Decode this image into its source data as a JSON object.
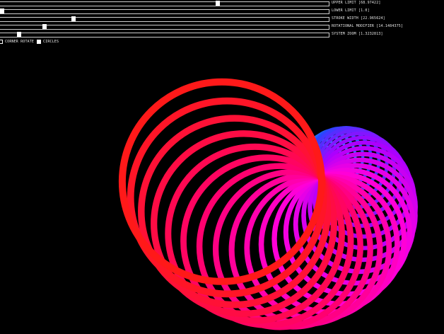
{
  "sliders": [
    {
      "id": "upper-limit",
      "label": "UPPER LIMIT [68.97422]",
      "fraction": 0.664
    },
    {
      "id": "lower-limit",
      "label": "LOWER LIMIT [1.0]",
      "fraction": 0.0
    },
    {
      "id": "stroke-width",
      "label": "STROKE WIDTH [22.965624]",
      "fraction": 0.219
    },
    {
      "id": "rotational-modifier",
      "label": "ROTATIONAL MODIFIER [14.1484375]",
      "fraction": 0.13
    },
    {
      "id": "system-zoom",
      "label": "SYSTEM ZOOM [1.3232813]",
      "fraction": 0.053
    }
  ],
  "toggles": [
    {
      "id": "corner-rotate",
      "label": "CORNER ROTATE",
      "checked": false
    },
    {
      "id": "circles",
      "label": "CIRCLES",
      "checked": true
    }
  ],
  "colors": {
    "background": "#000000",
    "spiral_start": "#ffff00",
    "spiral_mid": "#00ffff",
    "spiral_blue": "#4040ff",
    "spiral_magenta": "#ff00ff",
    "spiral_end": "#ff1a1a"
  }
}
